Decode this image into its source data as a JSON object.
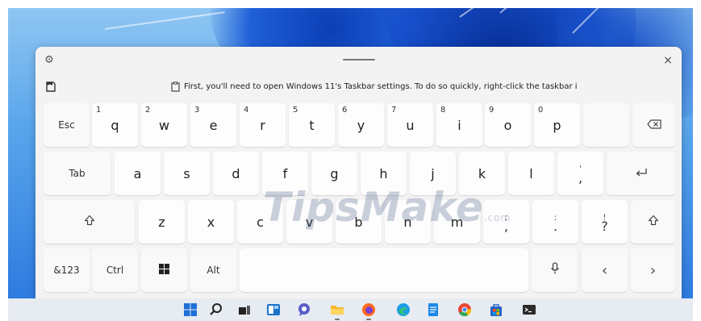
{
  "keyboard": {
    "suggestion_text": "First, you'll need to open Windows 11's Taskbar settings. To do so quickly, right-click the taskbar i",
    "close_label": "×",
    "icons": {
      "settings": "gear-icon",
      "close": "close-icon",
      "clipboard": "clipboard-icon",
      "suggestion": "document-icon"
    },
    "rows": [
      [
        {
          "label": "Esc",
          "kind": "word"
        },
        {
          "label": "q",
          "sup": "1"
        },
        {
          "label": "w",
          "sup": "2"
        },
        {
          "label": "e",
          "sup": "3"
        },
        {
          "label": "r",
          "sup": "4"
        },
        {
          "label": "t",
          "sup": "5"
        },
        {
          "label": "y",
          "sup": "6"
        },
        {
          "label": "u",
          "sup": "7"
        },
        {
          "label": "i",
          "sup": "8"
        },
        {
          "label": "o",
          "sup": "9"
        },
        {
          "label": "p",
          "sup": "0"
        },
        {
          "label": "",
          "kind": "spacer"
        },
        {
          "label": "⌫",
          "kind": "glyph",
          "icon": "backspace-icon"
        }
      ],
      [
        {
          "label": "Tab",
          "kind": "word"
        },
        {
          "label": "a"
        },
        {
          "label": "s"
        },
        {
          "label": "d"
        },
        {
          "label": "f"
        },
        {
          "label": "g"
        },
        {
          "label": "h"
        },
        {
          "label": "j"
        },
        {
          "label": "k"
        },
        {
          "label": "l"
        },
        {
          "label": "'",
          "sub": ",",
          "kind": "stack"
        },
        {
          "label": "↵",
          "kind": "glyph",
          "icon": "enter-icon"
        }
      ],
      [
        {
          "label": "⇧",
          "kind": "glyph",
          "icon": "shift-icon"
        },
        {
          "label": "z"
        },
        {
          "label": "x"
        },
        {
          "label": "c"
        },
        {
          "label": "v"
        },
        {
          "label": "b"
        },
        {
          "label": "n"
        },
        {
          "label": "m"
        },
        {
          "label": ";",
          "sub": ",",
          "kind": "stack"
        },
        {
          "label": ":",
          "sub": ".",
          "kind": "stack"
        },
        {
          "label": "!",
          "sub": "?",
          "kind": "stack"
        },
        {
          "label": "⇧",
          "kind": "glyph",
          "icon": "shift-icon"
        }
      ],
      [
        {
          "label": "&123",
          "kind": "word"
        },
        {
          "label": "Ctrl",
          "kind": "word"
        },
        {
          "label": "",
          "kind": "glyph",
          "icon": "windows-icon"
        },
        {
          "label": "Alt",
          "kind": "word"
        },
        {
          "label": "",
          "kind": "space"
        },
        {
          "label": "",
          "kind": "glyph",
          "icon": "microphone-icon"
        },
        {
          "label": "‹",
          "kind": "glyph",
          "icon": "chevron-left-icon"
        },
        {
          "label": "›",
          "kind": "glyph",
          "icon": "chevron-right-icon"
        }
      ]
    ]
  },
  "watermark": {
    "text": "TipsMake",
    "suffix": ".com"
  },
  "taskbar": {
    "icons": [
      "windows-start-icon",
      "search-icon",
      "task-view-icon",
      "widgets-icon",
      "chat-icon",
      "file-explorer-icon",
      "firefox-icon",
      "edge-icon",
      "notepad-icon",
      "chrome-icon",
      "store-icon",
      "terminal-icon"
    ],
    "colors": {
      "start": "#1f6fd8",
      "firefox": "#ff6a1a",
      "edge": "#1a9ee6",
      "chrome": "#34a853",
      "store": "#2563c9",
      "folder": "#f5b82e"
    }
  }
}
